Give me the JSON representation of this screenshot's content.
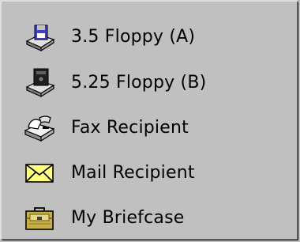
{
  "menu": {
    "items": [
      {
        "label": "3.5 Floppy (A)",
        "icon": "floppy-35-drive-icon"
      },
      {
        "label": "5.25 Floppy (B)",
        "icon": "floppy-525-drive-icon"
      },
      {
        "label": "Fax Recipient",
        "icon": "fax-icon"
      },
      {
        "label": "Mail Recipient",
        "icon": "mail-envelope-icon"
      },
      {
        "label": "My Briefcase",
        "icon": "briefcase-icon"
      }
    ]
  },
  "colors": {
    "menu_background": "#c0c0c0",
    "text": "#000000",
    "envelope": "#ffff80",
    "briefcase": "#c8b048"
  }
}
